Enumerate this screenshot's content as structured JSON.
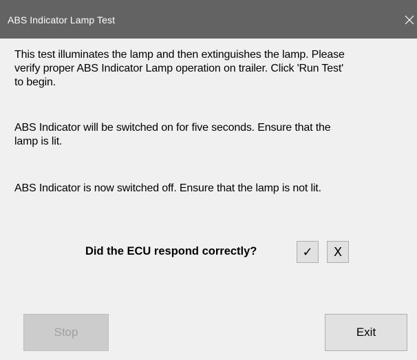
{
  "window": {
    "title": "ABS Indicator Lamp Test",
    "close_icon": "close-icon"
  },
  "messages": {
    "intro": "This test illuminates the lamp and then extinguishes the lamp. Please\nverify proper ABS Indicator Lamp operation on trailer. Click 'Run Test'\nto begin.",
    "switched_on": "ABS Indicator will be switched on for five seconds. Ensure that the\nlamp is lit.",
    "switched_off": "ABS Indicator is now switched off. Ensure that the lamp is not lit."
  },
  "prompt": {
    "question": "Did the ECU respond correctly?",
    "yes_label": "✓",
    "no_label": "X"
  },
  "buttons": {
    "stop_label": "Stop",
    "stop_enabled": false,
    "exit_label": "Exit"
  },
  "colors": {
    "titlebar": "#636363",
    "background": "#f0f0f0",
    "button_face": "#e1e1e1",
    "button_disabled": "#cccccc",
    "disabled_text": "#a0a0a0"
  }
}
